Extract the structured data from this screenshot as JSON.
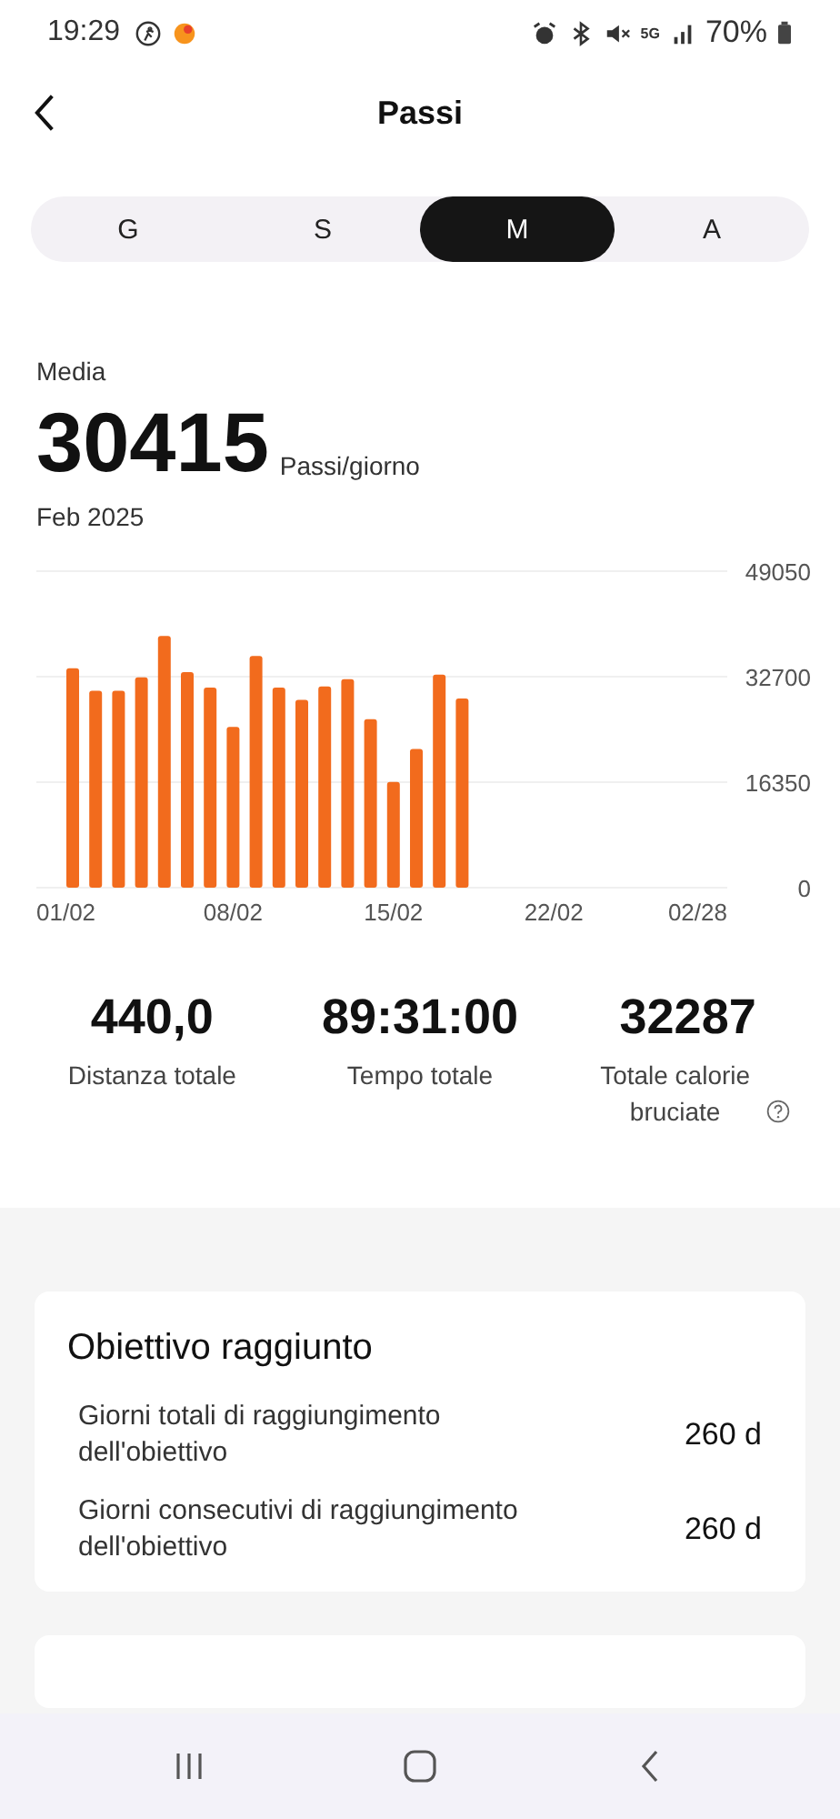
{
  "status_bar": {
    "time": "19:29",
    "network": "5G",
    "battery": "70%"
  },
  "header": {
    "title": "Passi"
  },
  "tabs": [
    {
      "label": "G",
      "selected": false
    },
    {
      "label": "S",
      "selected": false
    },
    {
      "label": "M",
      "selected": true
    },
    {
      "label": "A",
      "selected": false
    }
  ],
  "summary": {
    "label": "Media",
    "value": "30415",
    "unit": "Passi/giorno",
    "period": "Feb 2025"
  },
  "chart_data": {
    "type": "bar",
    "categories": [
      "01/02",
      null,
      null,
      null,
      null,
      null,
      null,
      "08/02",
      null,
      null,
      null,
      null,
      null,
      null,
      "15/02",
      null,
      null,
      null,
      null,
      null,
      null,
      "22/02",
      null,
      null,
      null,
      null,
      null,
      "02/28"
    ],
    "series": [
      {
        "color": "#f26b1d",
        "values": [
          34000,
          30500,
          30500,
          32600,
          39000,
          33400,
          31000,
          24900,
          35900,
          31000,
          29100,
          31200,
          32300,
          26100,
          16400,
          21500,
          33000,
          29300,
          null,
          null,
          null,
          null,
          null,
          null,
          null,
          null,
          null,
          null
        ]
      }
    ],
    "ylim": [
      0,
      49050
    ],
    "yticks": [
      0,
      16350,
      32700,
      49050
    ]
  },
  "stats": [
    {
      "value": "440,0",
      "label": "Distanza totale",
      "help": false
    },
    {
      "value": "89:31:00",
      "label": "Tempo totale",
      "help": false
    },
    {
      "value": "32287",
      "label": "Totale calorie bruciate",
      "help": true
    }
  ],
  "goal_card": {
    "title": "Obiettivo raggiunto",
    "rows": [
      {
        "label": "Giorni totali di raggiungimento dell'obiettivo",
        "value": "260 d"
      },
      {
        "label": "Giorni consecutivi di raggiungimento dell'obiettivo",
        "value": "260 d"
      }
    ]
  }
}
